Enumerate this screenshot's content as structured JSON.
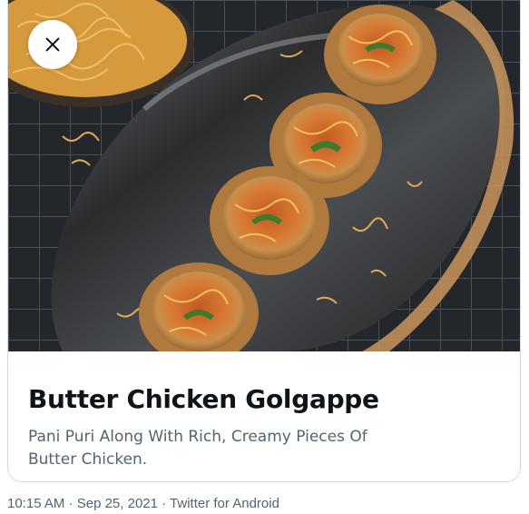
{
  "card": {
    "title": "Butter Chicken Golgappe",
    "description": "Pani Puri Along With Rich, Creamy Pieces Of Butter Chicken."
  },
  "close_button": {
    "icon": "close-icon"
  },
  "tweet_meta": {
    "time": "10:15 AM",
    "separator_1": " · ",
    "date": "Sep 25, 2021",
    "separator_2": " · ",
    "source": "Twitter for Android"
  }
}
